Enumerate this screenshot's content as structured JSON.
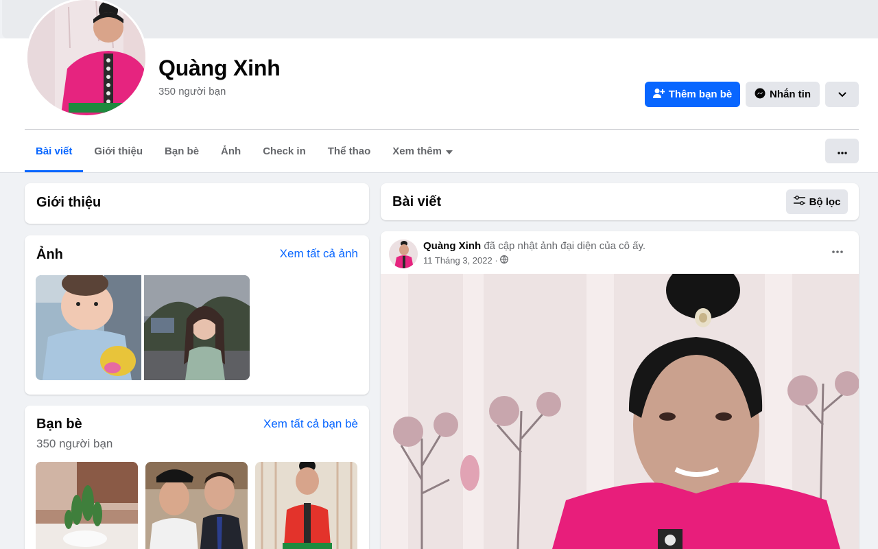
{
  "profile": {
    "name": "Quàng Xinh",
    "friend_count": "350 người bạn"
  },
  "actions": {
    "add_friend": "Thêm bạn bè",
    "message": "Nhắn tin"
  },
  "tabs": [
    {
      "label": "Bài viết",
      "active": true
    },
    {
      "label": "Giới thiệu"
    },
    {
      "label": "Bạn bè"
    },
    {
      "label": "Ảnh"
    },
    {
      "label": "Check in"
    },
    {
      "label": "Thể thao"
    },
    {
      "label": "Xem thêm"
    }
  ],
  "intro": {
    "title": "Giới thiệu"
  },
  "photos": {
    "title": "Ảnh",
    "see_all": "Xem tất cả ảnh"
  },
  "friends": {
    "title": "Bạn bè",
    "count": "350 người bạn",
    "see_all": "Xem tất cả bạn bè"
  },
  "posts": {
    "title": "Bài viết",
    "filter": "Bộ lọc"
  },
  "post": {
    "author": "Quàng Xinh",
    "action_text": " đã cập nhật ảnh đại diện của cô ấy.",
    "date": "11 Tháng 3, 2022 ·"
  },
  "colors": {
    "accent": "#0866ff",
    "secondary_button": "#e4e6eb",
    "page_bg": "#f0f2f5"
  }
}
